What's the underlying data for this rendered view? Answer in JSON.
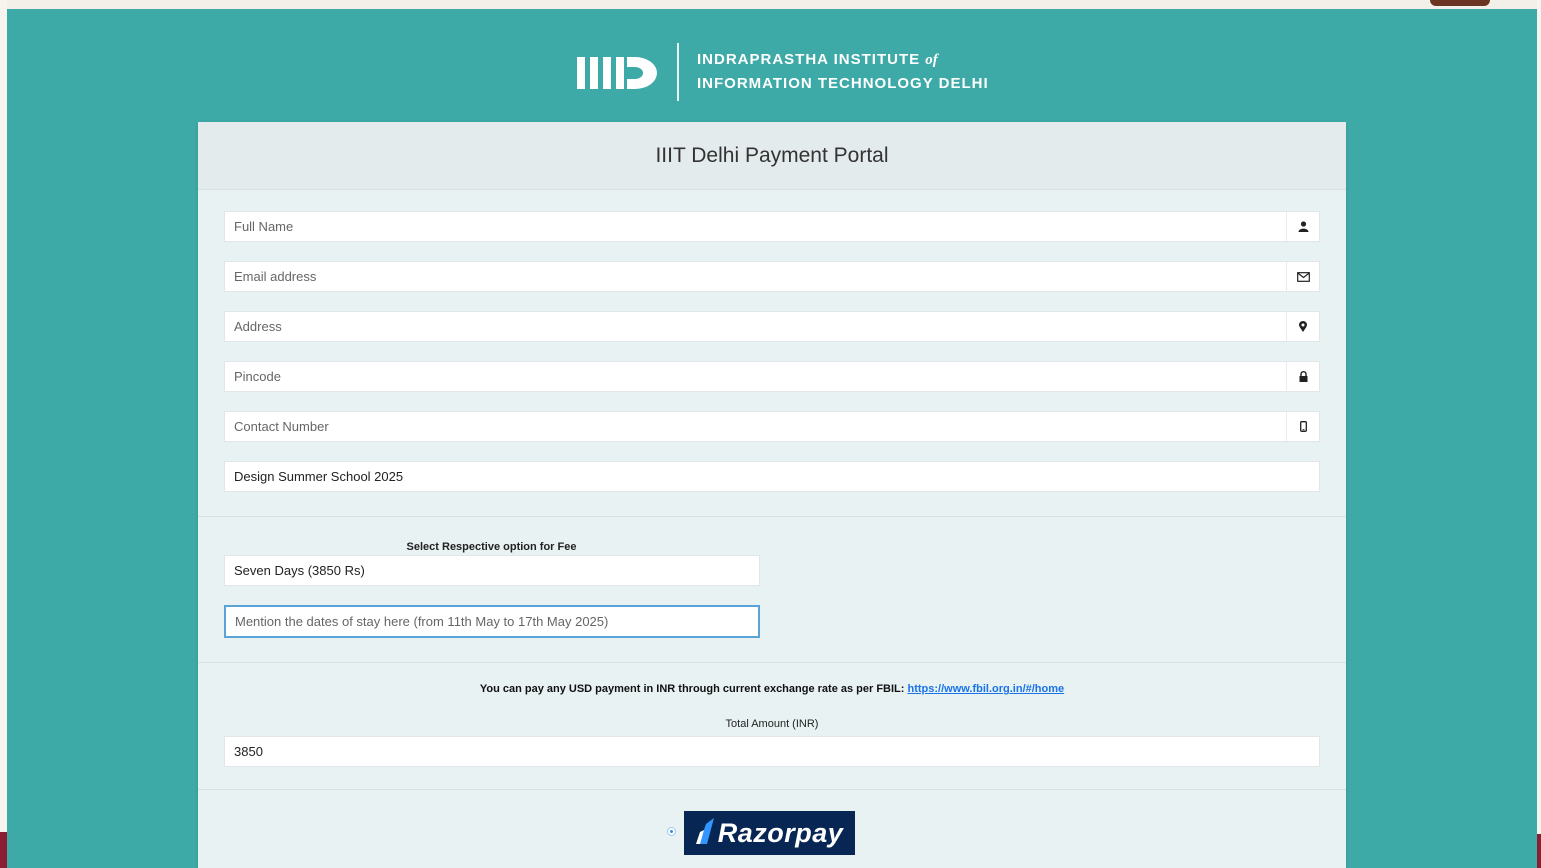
{
  "header": {
    "logo_line1": "INDRAPRASTHA INSTITUTE",
    "logo_of": "of",
    "logo_line2": "INFORMATION TECHNOLOGY",
    "logo_delhi": "DELHI"
  },
  "card": {
    "title": "IIIT Delhi Payment Portal"
  },
  "form": {
    "full_name": {
      "placeholder": "Full Name",
      "icon": "user-icon"
    },
    "email": {
      "placeholder": "Email address",
      "icon": "envelope-icon"
    },
    "address": {
      "placeholder": "Address",
      "icon": "map-marker-icon"
    },
    "pincode": {
      "placeholder": "Pincode",
      "icon": "lock-icon"
    },
    "contact": {
      "placeholder": "Contact Number",
      "icon": "mobile-icon"
    },
    "course": {
      "value": "Design Summer School 2025"
    },
    "fee_label": "Select Respective option for Fee",
    "fee_option": "Seven Days (3850 Rs)",
    "stay_dates": {
      "placeholder": "Mention the dates of stay here (from 11th May to 17th May 2025)"
    },
    "usd_note": "You can pay any USD payment in INR through current exchange rate as per FBIL:",
    "usd_link": "https://www.fbil.org.in/#/home",
    "total_label": "Total Amount (INR)",
    "total_value": "3850"
  },
  "payment": {
    "provider": "Razorpay",
    "selected": true
  },
  "colors": {
    "background": "#3eaaa7",
    "razorpay": "#072654",
    "link": "#1a73e8"
  }
}
